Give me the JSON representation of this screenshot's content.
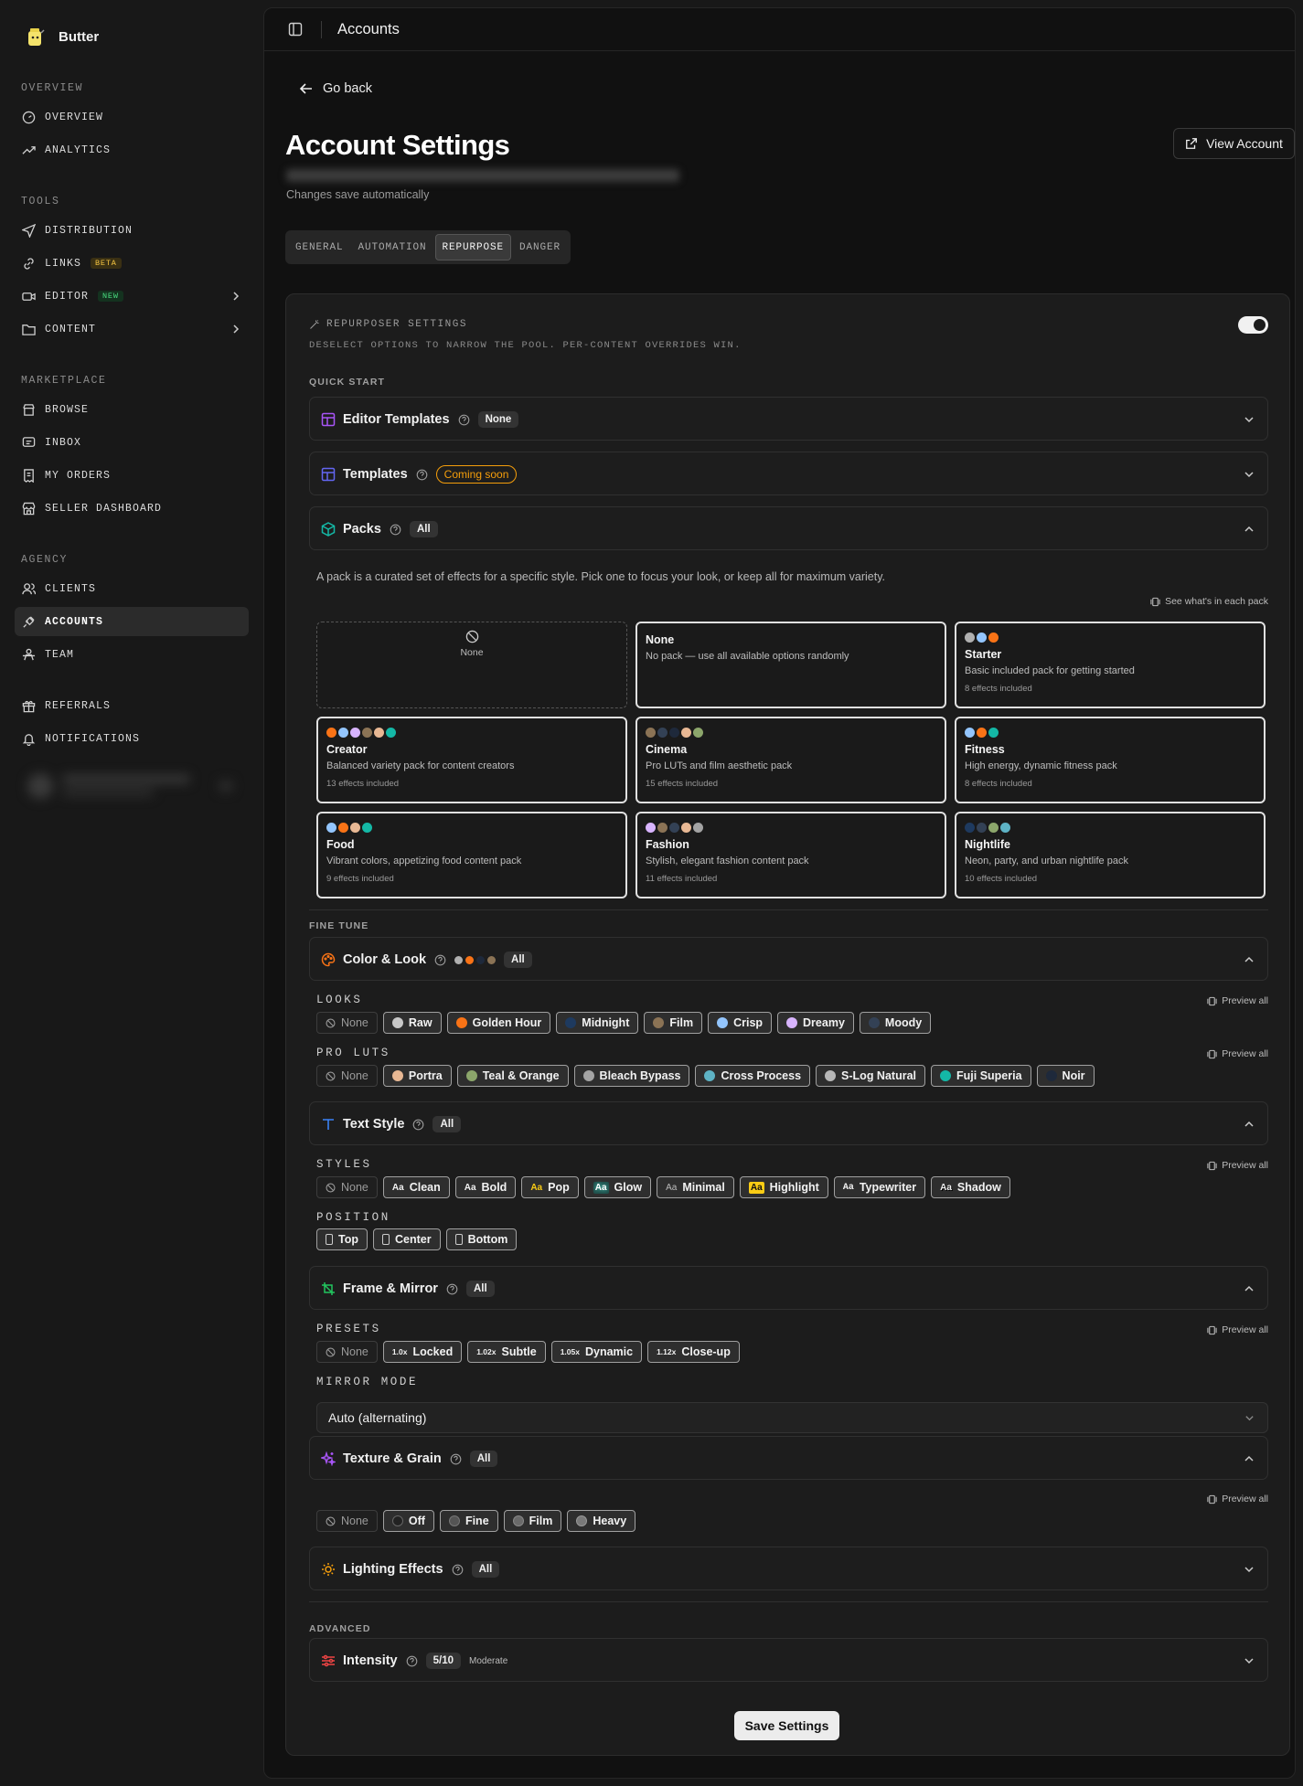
{
  "brand": {
    "name": "Butter"
  },
  "sidebar": {
    "sections": {
      "overview": "OVERVIEW",
      "tools": "TOOLS",
      "marketplace": "MARKETPLACE",
      "agency": "AGENCY"
    },
    "items": {
      "overview": "OVERVIEW",
      "analytics": "ANALYTICS",
      "distribution": "DISTRIBUTION",
      "links": "LINKS",
      "links_badge": "BETA",
      "editor": "EDITOR",
      "editor_badge": "NEW",
      "content": "CONTENT",
      "browse": "BROWSE",
      "inbox": "INBOX",
      "my_orders": "MY ORDERS",
      "seller_dashboard": "SELLER DASHBOARD",
      "clients": "CLIENTS",
      "accounts": "ACCOUNTS",
      "team": "TEAM",
      "referrals": "REFERRALS",
      "notifications": "NOTIFICATIONS"
    }
  },
  "topbar": {
    "title": "Accounts"
  },
  "page": {
    "go_back": "Go back",
    "title": "Account Settings",
    "autosave": "Changes save automatically",
    "view_account": "View Account"
  },
  "tabs": [
    "GENERAL",
    "AUTOMATION",
    "REPURPOSE",
    "DANGER"
  ],
  "panel": {
    "title": "REPURPOSER SETTINGS",
    "subtitle": "DESELECT OPTIONS TO NARROW THE POOL. PER-CONTENT OVERRIDES WIN.",
    "enabled": true,
    "quick_start": "QUICK START",
    "fine_tune": "FINE TUNE",
    "advanced": "ADVANCED",
    "editor_templates": {
      "label": "Editor Templates",
      "value": "None"
    },
    "templates": {
      "label": "Templates",
      "value": "Coming soon"
    },
    "packs": {
      "label": "Packs",
      "value": "All",
      "description": "A pack is a curated set of effects for a specific style. Pick one to focus your look, or keep all for maximum variety.",
      "see_all": "See what's in each pack"
    },
    "pack_cards": {
      "none_tile": "None",
      "none": {
        "name": "None",
        "desc": "No pack — use all available options randomly"
      },
      "starter": {
        "name": "Starter",
        "desc": "Basic included pack for getting started",
        "count": "8 effects included"
      },
      "creator": {
        "name": "Creator",
        "desc": "Balanced variety pack for content creators",
        "count": "13 effects included"
      },
      "cinema": {
        "name": "Cinema",
        "desc": "Pro LUTs and film aesthetic pack",
        "count": "15 effects included"
      },
      "fitness": {
        "name": "Fitness",
        "desc": "High energy, dynamic fitness pack",
        "count": "8 effects included"
      },
      "food": {
        "name": "Food",
        "desc": "Vibrant colors, appetizing food content pack",
        "count": "9 effects included"
      },
      "fashion": {
        "name": "Fashion",
        "desc": "Stylish, elegant fashion content pack",
        "count": "11 effects included"
      },
      "nightlife": {
        "name": "Nightlife",
        "desc": "Neon, party, and urban nightlife pack",
        "count": "10 effects included"
      }
    },
    "color_look": {
      "label": "Color & Look",
      "value": "All",
      "looks_label": "LOOKS",
      "pro_luts_label": "PRO LUTS",
      "preview_all": "Preview all",
      "looks": [
        "None",
        "Raw",
        "Golden Hour",
        "Midnight",
        "Film",
        "Crisp",
        "Dreamy",
        "Moody"
      ],
      "luts": [
        "None",
        "Portra",
        "Teal & Orange",
        "Bleach Bypass",
        "Cross Process",
        "S-Log Natural",
        "Fuji Superia",
        "Noir"
      ]
    },
    "text_style": {
      "label": "Text Style",
      "value": "All",
      "styles_label": "STYLES",
      "position_label": "POSITION",
      "preview_all": "Preview all",
      "styles": [
        "None",
        "Clean",
        "Bold",
        "Pop",
        "Glow",
        "Minimal",
        "Highlight",
        "Typewriter",
        "Shadow"
      ],
      "aa": "Aa",
      "positions": [
        "Top",
        "Center",
        "Bottom"
      ]
    },
    "frame_mirror": {
      "label": "Frame & Mirror",
      "value": "All",
      "presets_label": "PRESETS",
      "mirror_label": "MIRROR MODE",
      "preview_all": "Preview all",
      "presets": [
        "None",
        "Locked",
        "Subtle",
        "Dynamic",
        "Close-up"
      ],
      "scales": [
        "1.0x",
        "1.02x",
        "1.05x",
        "1.12x"
      ],
      "mirror_value": "Auto (alternating)"
    },
    "texture_grain": {
      "label": "Texture & Grain",
      "value": "All",
      "preview_all": "Preview all",
      "options": [
        "None",
        "Off",
        "Fine",
        "Film",
        "Heavy"
      ]
    },
    "lighting": {
      "label": "Lighting Effects",
      "value": "All"
    },
    "intensity": {
      "label": "Intensity",
      "value": "5/10",
      "level": "Moderate"
    },
    "save": "Save Settings"
  },
  "colors": {
    "accent_orange": "#f59e0b",
    "toggle_on": "#f1f1f1"
  }
}
